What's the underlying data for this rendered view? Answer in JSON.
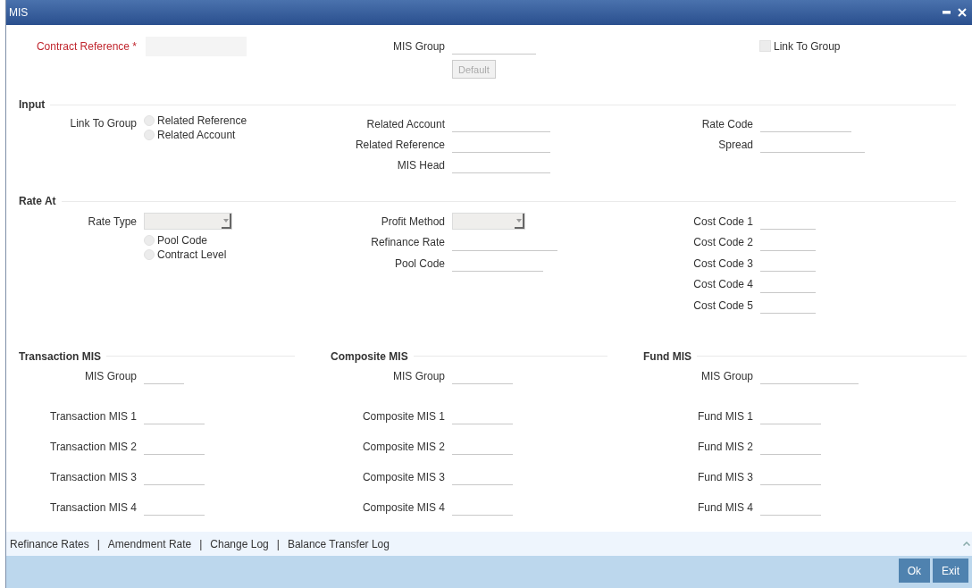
{
  "window": {
    "title": "MIS"
  },
  "top": {
    "contract_reference": {
      "label": "Contract Reference",
      "required": "*"
    },
    "mis_group": {
      "label": "MIS Group"
    },
    "default_button": {
      "label": "Default",
      "disabled": true
    },
    "link_to_group": {
      "label": "Link To Group",
      "checked": false
    }
  },
  "input": {
    "title": "Input",
    "link_to_group": {
      "label": "Link To Group",
      "options": [
        {
          "label": "Related Reference",
          "selected": false
        },
        {
          "label": "Related Account",
          "selected": false
        }
      ]
    },
    "middle": [
      {
        "label": "Related Account"
      },
      {
        "label": "Related Reference"
      },
      {
        "label": "MIS Head"
      }
    ],
    "right": [
      {
        "label": "Rate Code"
      },
      {
        "label": "Spread"
      }
    ]
  },
  "rate_at": {
    "title": "Rate At",
    "rate_type": {
      "label": "Rate Type",
      "options": [
        {
          "label": "Pool Code",
          "selected": false
        },
        {
          "label": "Contract Level",
          "selected": false
        }
      ]
    },
    "profit_method": {
      "label": "Profit Method"
    },
    "middle": [
      {
        "label": "Refinance Rate"
      },
      {
        "label": "Pool Code"
      }
    ],
    "right": [
      {
        "label": "Cost Code 1"
      },
      {
        "label": "Cost Code 2"
      },
      {
        "label": "Cost Code 3"
      },
      {
        "label": "Cost Code 4"
      },
      {
        "label": "Cost Code 5"
      }
    ]
  },
  "mis_sections": [
    {
      "title": "Transaction MIS",
      "group_label": "MIS Group",
      "fields": [
        {
          "label": "Transaction MIS 1"
        },
        {
          "label": "Transaction MIS 2"
        },
        {
          "label": "Transaction MIS 3"
        },
        {
          "label": "Transaction MIS 4"
        }
      ]
    },
    {
      "title": "Composite MIS",
      "group_label": "MIS Group",
      "fields": [
        {
          "label": "Composite MIS 1"
        },
        {
          "label": "Composite MIS 2"
        },
        {
          "label": "Composite MIS 3"
        },
        {
          "label": "Composite MIS 4"
        }
      ]
    },
    {
      "title": "Fund MIS",
      "group_label": "MIS Group",
      "fields": [
        {
          "label": "Fund MIS 1"
        },
        {
          "label": "Fund MIS 2"
        },
        {
          "label": "Fund MIS 3"
        },
        {
          "label": "Fund MIS 4"
        }
      ]
    }
  ],
  "footer": {
    "links": [
      "Refinance Rates",
      "Amendment Rate",
      "Change Log",
      "Balance Transfer Log"
    ],
    "separator": "|"
  },
  "buttons": [
    "Ok",
    "Exit"
  ]
}
